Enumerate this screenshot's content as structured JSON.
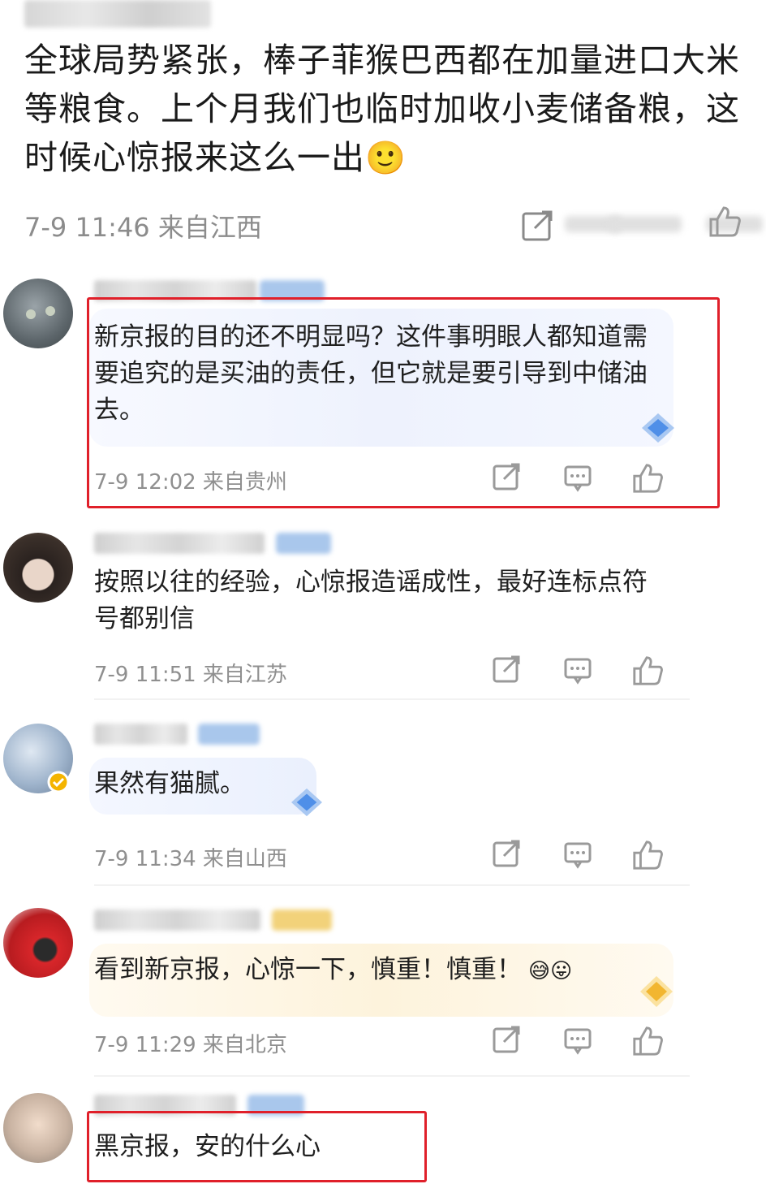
{
  "post": {
    "text": "全球局势紧张，棒子菲猴巴西都在加量进口大米等粮食。上个月我们也临时加收小麦储备粮，这时候心惊报来这么一出",
    "emoji": "🙂",
    "meta": "7-9 11:46 来自江西"
  },
  "comments": [
    {
      "text": "新京报的目的还不明显吗？这件事明眼人都知道需要追究的是买油的责任，但它就是要引导到中储油去。",
      "meta": "7-9 12:02 来自贵州",
      "highlighted": true
    },
    {
      "text": "按照以往的经验，心惊报造谣成性，最好连标点符号都别信",
      "meta": "7-9 11:51 来自江苏",
      "highlighted": false
    },
    {
      "text": "果然有猫腻。",
      "meta": "7-9 11:34 来自山西",
      "highlighted": false
    },
    {
      "text": "看到新京报，心惊一下，慎重！慎重！",
      "emoji": "😅😛",
      "meta": "7-9 11:29 来自北京",
      "highlighted": false
    },
    {
      "text": "黑京报，安的什么心",
      "highlighted": true
    }
  ],
  "icons": [
    "share-icon",
    "comment-icon",
    "like-icon"
  ],
  "colors": {
    "highlight_border": "#e0202a",
    "meta_text": "#8f8f8f"
  }
}
